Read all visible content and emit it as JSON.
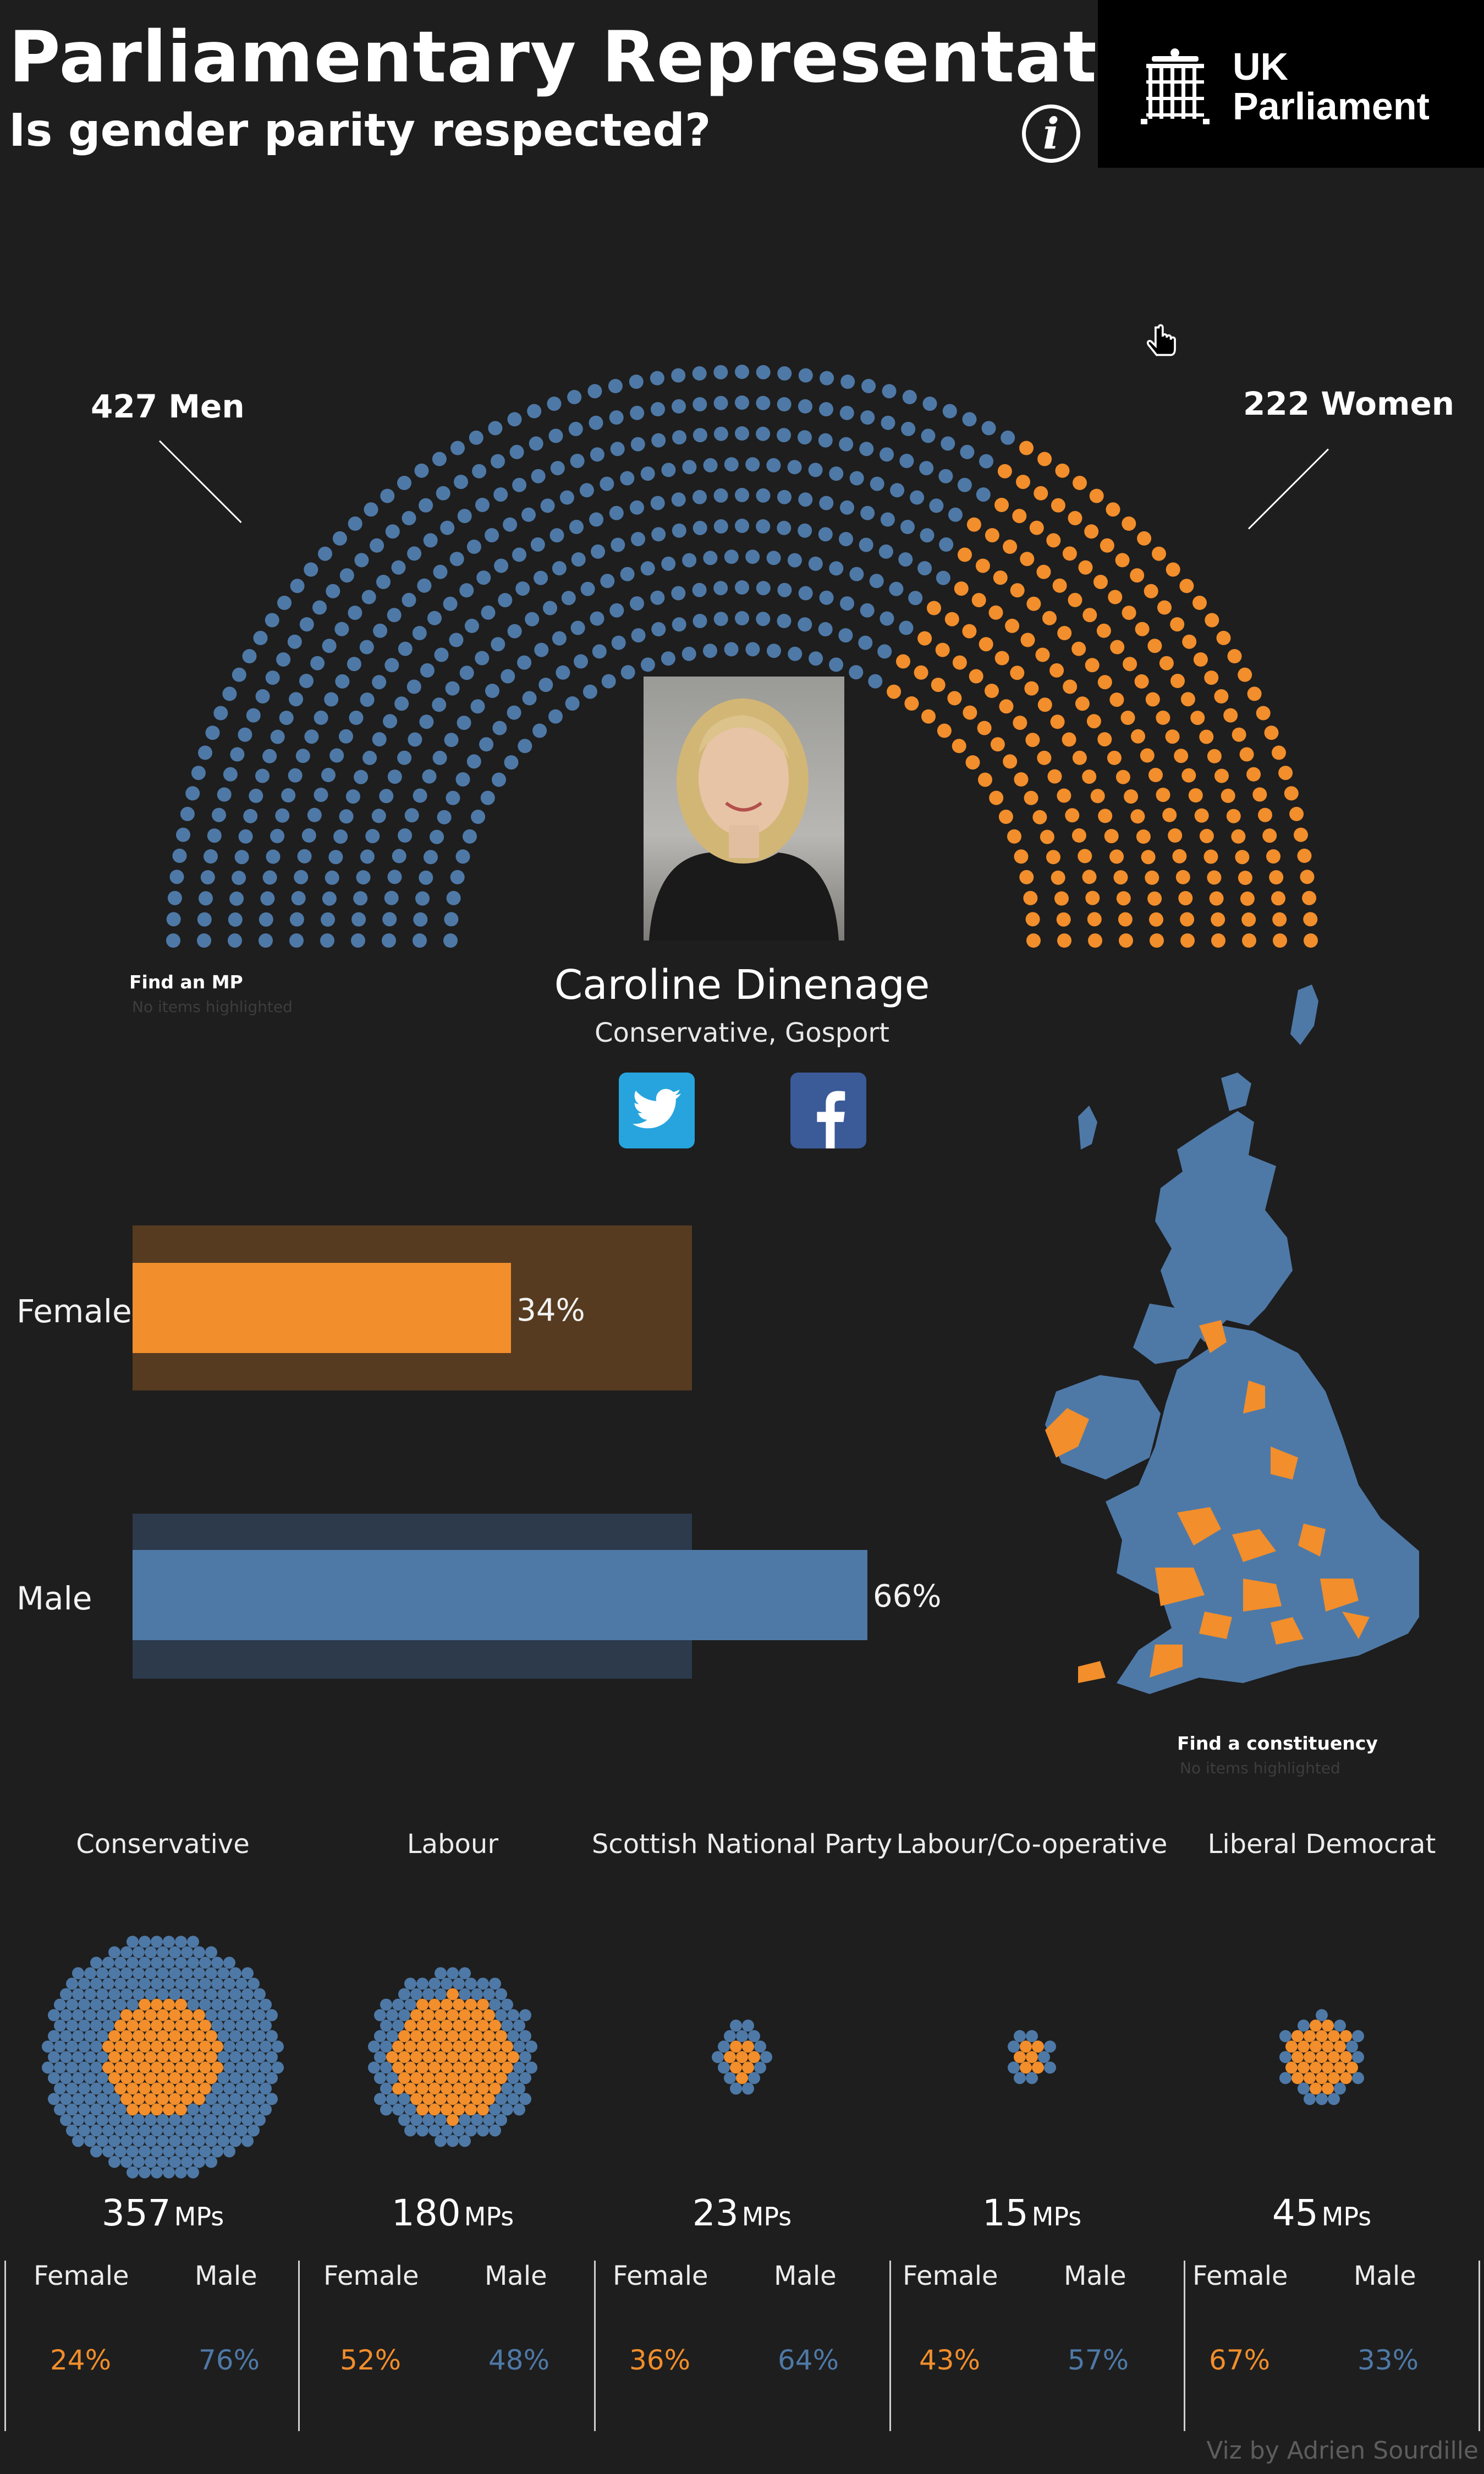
{
  "header": {
    "title": "Parliamentary Representation",
    "subtitle": "Is gender parity respected?",
    "info_icon": "info-icon",
    "logo_line1": "UK",
    "logo_line2": "Parliament"
  },
  "colors": {
    "background": "#1e1e1e",
    "male": "#4e79a7",
    "female": "#f28e2b",
    "female_track": "#563b20",
    "male_track": "#2c3a4c"
  },
  "parliament": {
    "men_label": "427 Men",
    "women_label": "222 Women",
    "men": 427,
    "women": 222
  },
  "find_mp": {
    "title": "Find an MP",
    "sub": "No items highlighted"
  },
  "selected_mp": {
    "name": "Caroline Dinenage",
    "detail": "Conservative, Gosport",
    "twitter_icon": "twitter-icon",
    "facebook_icon": "facebook-icon"
  },
  "gender_bars": {
    "female_label": "Female",
    "female_pct_text": "34%",
    "female_pct": 34,
    "male_label": "Male",
    "male_pct_text": "66%",
    "male_pct": 66
  },
  "find_constituency": {
    "title": "Find a constituency",
    "sub": "No items highlighted"
  },
  "parties": [
    {
      "name": "Conservative",
      "count": "357",
      "unit": "MPs",
      "female_label": "Female",
      "male_label": "Male",
      "female": "24%",
      "male": "76%"
    },
    {
      "name": "Labour",
      "count": "180",
      "unit": "MPs",
      "female_label": "Female",
      "male_label": "Male",
      "female": "52%",
      "male": "48%"
    },
    {
      "name": "Scottish National Party",
      "count": "23",
      "unit": "MPs",
      "female_label": "Female",
      "male_label": "Male",
      "female": "36%",
      "male": "64%"
    },
    {
      "name": "Labour/Co-operative",
      "count": "15",
      "unit": "MPs",
      "female_label": "Female",
      "male_label": "Male",
      "female": "43%",
      "male": "57%"
    },
    {
      "name": "Liberal Democrat",
      "count": "45",
      "unit": "MPs",
      "female_label": "Female",
      "male_label": "Male",
      "female": "67%",
      "male": "33%"
    }
  ],
  "footer": "Viz by Adrien Sourdille"
}
